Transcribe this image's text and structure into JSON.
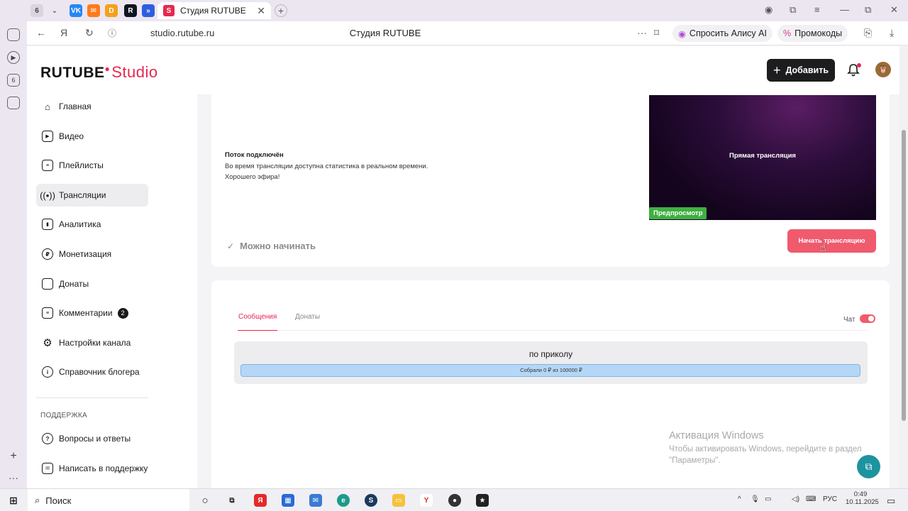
{
  "browser": {
    "tab_counter": "6",
    "active_tab_title": "Студия RUTUBE",
    "url": "studio.rutube.ru",
    "page_title": "Студия RUTUBE",
    "alice_label": "Спросить Алису AI",
    "promo_label": "Промокоды"
  },
  "header": {
    "logo": "RUTUBE",
    "logo_suffix": "Studio",
    "add_label": "Добавить"
  },
  "sidebar": {
    "items": [
      {
        "label": "Главная",
        "icon": "home-icon"
      },
      {
        "label": "Видео",
        "icon": "video-icon"
      },
      {
        "label": "Плейлисты",
        "icon": "playlist-icon"
      },
      {
        "label": "Трансляции",
        "icon": "broadcast-icon"
      },
      {
        "label": "Аналитика",
        "icon": "analytics-icon"
      },
      {
        "label": "Монетизация",
        "icon": "ruble-icon"
      },
      {
        "label": "Донаты",
        "icon": "wallet-icon"
      },
      {
        "label": "Комментарии",
        "icon": "comment-icon",
        "badge": "2"
      },
      {
        "label": "Настройки канала",
        "icon": "gear-icon"
      },
      {
        "label": "Справочник блогера",
        "icon": "info-icon"
      }
    ],
    "support_title": "ПОДДЕРЖКА",
    "support_items": [
      {
        "label": "Вопросы и ответы",
        "icon": "question-icon"
      },
      {
        "label": "Написать в поддержку",
        "icon": "mail-icon"
      }
    ]
  },
  "stream": {
    "status_title": "Поток подключён",
    "status_line1": "Во время трансляции доступна статистика в реальном времени.",
    "status_line2": "Хорошего эфира!",
    "preview_title": "Прямая трансляция",
    "preview_badge": "Предпросмотр",
    "ready_label": "Можно начинать",
    "start_label": "Начать трансляцию"
  },
  "chat": {
    "tabs": [
      "Сообщения",
      "Донаты"
    ],
    "chat_label": "Чат",
    "goal_title": "по приколу",
    "goal_text": "Собрали 0 ₽  из 100000 ₽",
    "goal_progress": 0
  },
  "watermark": {
    "title": "Активация Windows",
    "line1": "Чтобы активировать Windows, перейдите в раздел",
    "line2": "\"Параметры\"."
  },
  "taskbar": {
    "search_label": "Поиск",
    "lang": "РУС",
    "time": "0:49",
    "date": "10.11.2025"
  },
  "colors": {
    "accent": "#e6284f",
    "start_button": "#f05a6d",
    "preview_badge": "#3fb041",
    "goal_bar": "#b5d7f5"
  }
}
